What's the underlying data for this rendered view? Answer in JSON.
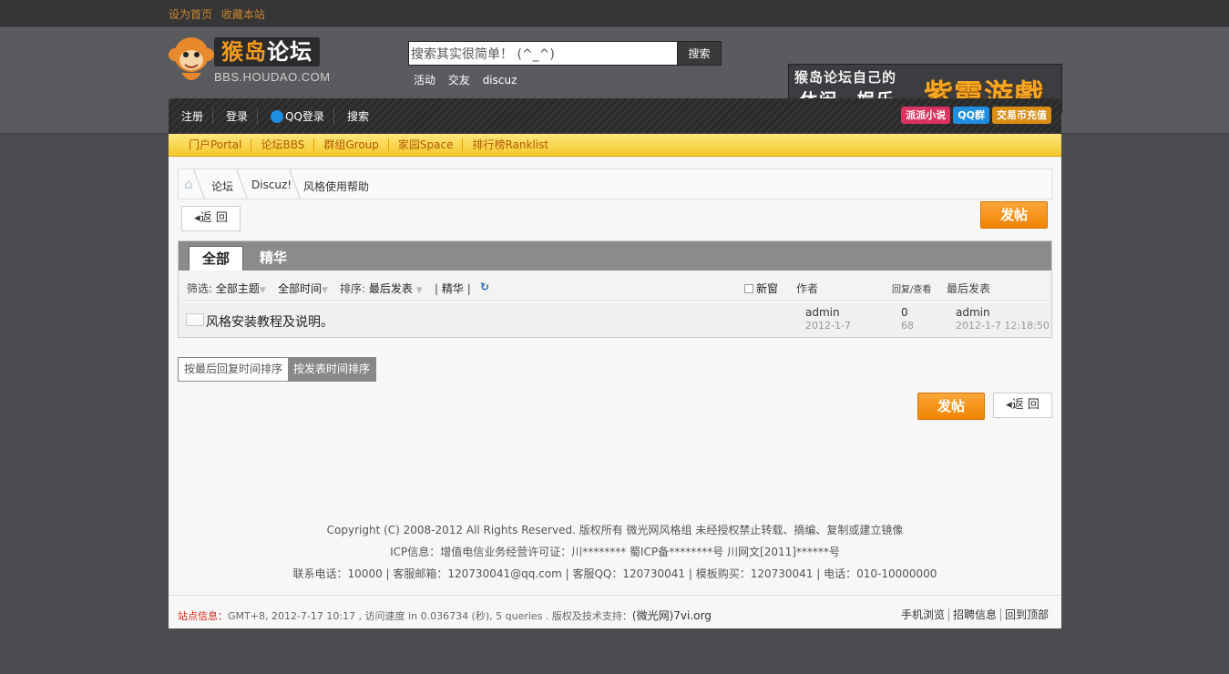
{
  "topbar": {
    "set_home": "设为首页",
    "bookmark": "收藏本站"
  },
  "logo": {
    "cn_a": "猴岛",
    "cn_b": "论坛",
    "en": "BBS.HOUDAO.COM"
  },
  "search": {
    "value": "搜索其实很简单！ (^_^)",
    "button": "搜索"
  },
  "hotwords": [
    "活动",
    "交友",
    "discuz"
  ],
  "banner": {
    "line1": "猴岛论坛自己的",
    "line2": "休闲、娱乐",
    "big": "紫霞游戲"
  },
  "nav": {
    "items": [
      "注册",
      "登录",
      "QQ登录",
      "搜索"
    ],
    "badges": [
      "派派小说",
      "QQ群",
      "交易币充值"
    ]
  },
  "subnav": [
    "门户Portal",
    "论坛BBS",
    "群组Group",
    "家园Space",
    "排行榜Ranklist"
  ],
  "breadcrumb": [
    "论坛",
    "Discuz!",
    "风格使用帮助"
  ],
  "buttons": {
    "back": "返 回",
    "post": "发帖"
  },
  "tabs": [
    "全部",
    "精华"
  ],
  "filters": {
    "label": "筛选:",
    "type": "全部主题",
    "time": "全部时间",
    "sort_label": "排序:",
    "sort": "最后发表",
    "digest": "精华",
    "new_window": "新窗",
    "col_author": "作者",
    "col_replies": "回复/查看",
    "col_last": "最后发表"
  },
  "threads": [
    {
      "title": "风格安装教程及说明。",
      "author": "admin",
      "date": "2012-1-7",
      "replies": "0",
      "views": "68",
      "last_author": "admin",
      "last_time": "2012-1-7 12:18:50"
    }
  ],
  "sort_toggle": {
    "by_reply": "按最后回复时间排序",
    "by_post": "按发表时间排序"
  },
  "footer": {
    "line1": "Copyright (C) 2008-2012 All Rights Reserved. 版权所有 微光网风格组 未经授权禁止转载、摘编、复制或建立镜像",
    "line2": "ICP信息：增值电信业务经营许可证：川******** 蜀ICP备********号 川网文[2011]******号",
    "line3": "联系电话：10000 | 客服邮箱：120730041@qq.com | 客服QQ：120730041 | 模板购买：120730041 | 电话：010-10000000",
    "info_label": "站点信息：",
    "info": "GMT+8, 2012-7-17 10:17 , 访问速度 in 0.036734 (秒), 5 queries . 版权及技术支持：",
    "site": "(微光网)7vi.org",
    "links": [
      "手机浏览",
      "招聘信息",
      "回到顶部"
    ]
  },
  "colors": {
    "accent": "#f18300",
    "subnav": "#f5c92c",
    "background": "#4c4d50"
  }
}
